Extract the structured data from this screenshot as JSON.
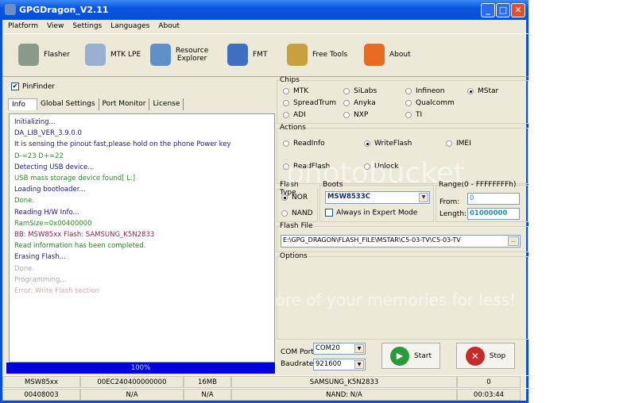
{
  "window": {
    "title": "GPGDragon_V2.11",
    "min": "_",
    "max": "□",
    "close": "✕"
  },
  "menu": [
    "Platform",
    "View",
    "Settings",
    "Languages",
    "About"
  ],
  "toolbar": [
    {
      "label": "Flasher",
      "icon": "phone-icon",
      "color": "#8a9a8a"
    },
    {
      "label": "MTK LPE",
      "icon": "document-icon",
      "color": "#9ab0d0"
    },
    {
      "label": "Resource\nExplorer",
      "icon": "folder-film-icon",
      "color": "#5f8fc8"
    },
    {
      "label": "FMT",
      "icon": "monitor-icon",
      "color": "#3f6fc0"
    },
    {
      "label": "Free Tools",
      "icon": "tools-icon",
      "color": "#c8a040"
    },
    {
      "label": "About",
      "icon": "house-icon",
      "color": "#e86a20"
    }
  ],
  "left": {
    "pinfinder": {
      "label": "PinFinder",
      "checked": true
    },
    "tabs": [
      "Info",
      "Global Settings",
      "Port Monitor",
      "License"
    ],
    "log": [
      {
        "text": "Initializing...",
        "color": "#1a1a7a"
      },
      {
        "text": "DA_LIB_VER_3.9.0.0",
        "color": "#1a1a7a"
      },
      {
        "text": "It is sensing the pinout fast,please hold on the phone Power key",
        "color": "#1a1a7a"
      },
      {
        "text": "D-=23  D+=22",
        "color": "#2a8a2a"
      },
      {
        "text": "Detecting USB device...",
        "color": "#1a1a7a"
      },
      {
        "text": "USB mass storage device found[ L:]",
        "color": "#2a8a2a"
      },
      {
        "text": "Loading bootloader...",
        "color": "#1a1a7a"
      },
      {
        "text": "Done.",
        "color": "#2a8a2a"
      },
      {
        "text": "Reading H/W Info...",
        "color": "#1a1a7a"
      },
      {
        "text": "RamSize=0x00400000",
        "color": "#2a8a2a"
      },
      {
        "text": "BB: MSW85xx      Flash: SAMSUNG_K5N2833",
        "color": "#8a2050"
      },
      {
        "text": "Read information has been completed.",
        "color": "#2a7a2a"
      },
      {
        "text": "Erasing Flash...",
        "color": "#1a1a7a"
      },
      {
        "text": "Done.",
        "color": "#a8b0a8"
      },
      {
        "text": "Programming...",
        "color": "#a8a8b8"
      },
      {
        "text": "Error: Write Flash section",
        "color": "#d8a8a8"
      }
    ],
    "progress": {
      "label": "100%",
      "value": 100
    }
  },
  "chips": {
    "title": "Chips",
    "options": [
      "MTK",
      "SiLabs",
      "Infineon",
      "MStar",
      "SpreadTrum",
      "Anyka",
      "Qualcomm",
      "ADI",
      "NXP",
      "TI"
    ],
    "selected": "MStar"
  },
  "actions": {
    "title": "Actions",
    "options": [
      "ReadInfo",
      "WriteFlash",
      "IMEI",
      "ReadFlash",
      "Unlock"
    ],
    "selected": "WriteFlash"
  },
  "flash_type": {
    "title": "Flash Type",
    "options": [
      "NOR",
      "NAND"
    ],
    "selected": "NOR"
  },
  "boots": {
    "title": "Boots",
    "value": "MSW8533C",
    "expert_label": "Always in Expert Mode",
    "expert_checked": false
  },
  "range": {
    "title": "Range(0 - FFFFFFFFh)",
    "from_label": "From:",
    "from": "0",
    "length_label": "Length:",
    "length": "01000000"
  },
  "flash_file": {
    "title": "Flash File",
    "value": "E:\\GPG_DRAGON\\FLASH_FILE\\MSTAR\\C5-03-TV\\C5-03-TV",
    "browse": "..."
  },
  "options": {
    "title": "Options"
  },
  "port": {
    "com_label": "COM Port",
    "com": "COM20",
    "baud_label": "Baudrate",
    "baud": "921600"
  },
  "buttons": {
    "start": "Start",
    "stop": "Stop"
  },
  "status": [
    [
      "MSW85xx",
      "00EC240400000000",
      "16MB",
      "SAMSUNG_K5N2833",
      "0"
    ],
    [
      "00408003",
      "N/A",
      "N/A",
      "NAND: N/A",
      "00:03:44"
    ]
  ],
  "watermark": [
    "photobucket",
    "Protect more of your memories for less!"
  ]
}
